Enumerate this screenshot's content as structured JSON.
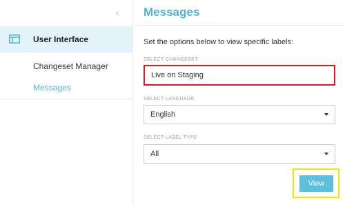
{
  "sidebar": {
    "section": {
      "icon": "window-icon",
      "label": "User Interface"
    },
    "items": [
      {
        "label": "Changeset Manager",
        "active": false
      },
      {
        "label": "Messages",
        "active": true
      }
    ]
  },
  "main": {
    "title": "Messages",
    "intro": "Set the options below to view specific labels:",
    "changeset": {
      "label": "SELECT CHANGESET",
      "value": "Live on Staging"
    },
    "language": {
      "label": "SELECT LANGUAGE",
      "value": "English"
    },
    "label_type": {
      "label": "SELECT LABEL TYPE",
      "value": "All"
    },
    "view_button": "View"
  },
  "colors": {
    "accent": "#4fb3d3",
    "button": "#5bc0de",
    "section_bg": "#e3f2f8",
    "highlight_red": "#e0141e",
    "highlight_yellow": "#f2e600"
  }
}
